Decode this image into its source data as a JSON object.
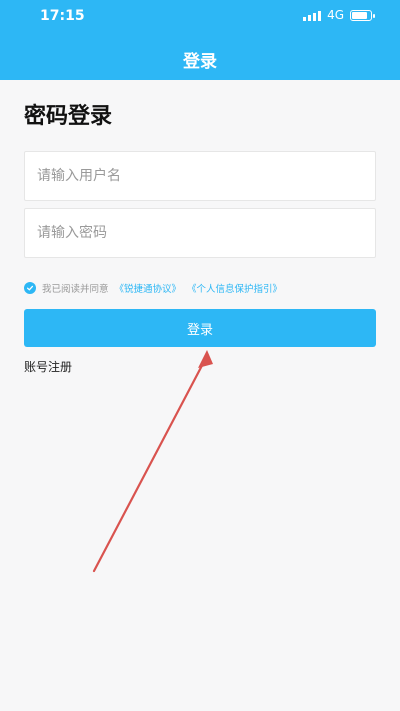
{
  "status_bar": {
    "time": "17:15",
    "network": "4G"
  },
  "header": {
    "title": "登录"
  },
  "main": {
    "heading": "密码登录",
    "username": {
      "placeholder": "请输入用户名",
      "value": ""
    },
    "password": {
      "placeholder": "请输入密码",
      "value": ""
    },
    "agreement": {
      "checked": true,
      "prefix": "我已阅读并同意",
      "link1": "《锐捷通协议》",
      "link2": "《个人信息保护指引》"
    },
    "login_button": "登录",
    "register_link": "账号注册"
  },
  "colors": {
    "primary": "#2db7f5",
    "background": "#f7f7f8",
    "annotation_arrow": "#d9534f"
  }
}
